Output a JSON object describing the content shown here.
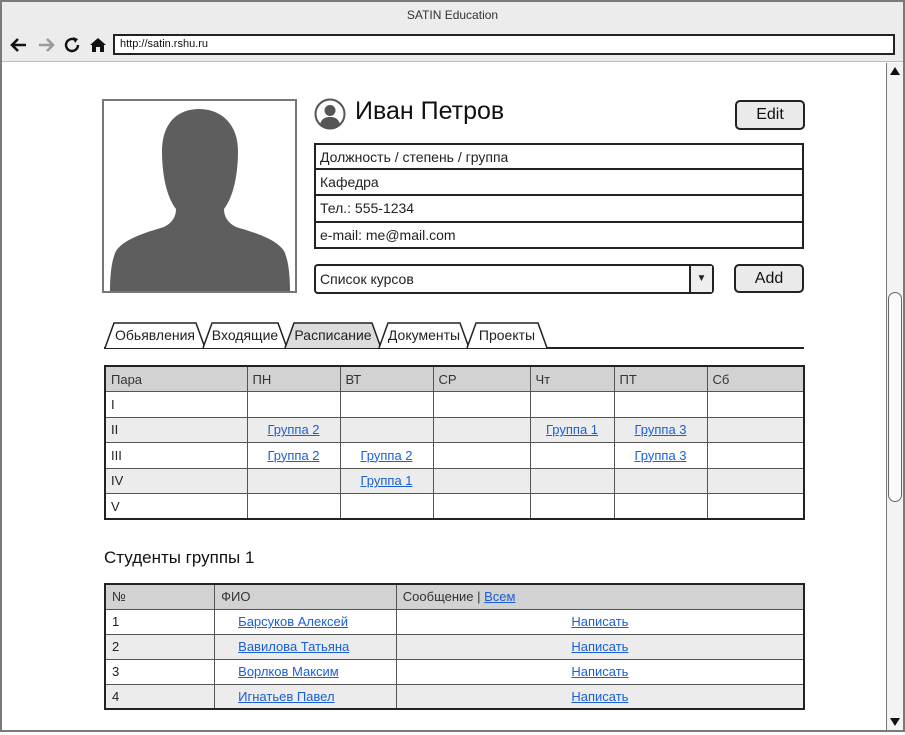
{
  "window": {
    "title": "SATIN Education"
  },
  "browser": {
    "url": "http://satin.rshu.ru"
  },
  "profile": {
    "name": "Иван Петров",
    "edit_label": "Edit",
    "fields": [
      "Должность / степень / группа",
      "Кафедра",
      "Тел.: 555-1234",
      "e-mail: me@mail.com"
    ],
    "course_select": "Список курсов",
    "add_label": "Add"
  },
  "tabs": [
    "Обьявления",
    "Входящие",
    "Расписание",
    "Документы",
    "Проекты"
  ],
  "active_tab": "Расписание",
  "schedule": {
    "headers": [
      "Пара",
      "ПН",
      "ВТ",
      "СР",
      "Чт",
      "ПТ",
      "Сб"
    ],
    "rows": [
      [
        "I",
        "",
        "",
        "",
        "",
        "",
        ""
      ],
      [
        "II",
        "Группа 2",
        "",
        "",
        "Группа 1",
        "Группа 3",
        ""
      ],
      [
        "III",
        "Группа 2",
        "Группа 2",
        "",
        "",
        "Группа 3",
        ""
      ],
      [
        "IV",
        "",
        "Группа 1",
        "",
        "",
        "",
        ""
      ],
      [
        "V",
        "",
        "",
        "",
        "",
        "",
        ""
      ]
    ]
  },
  "students": {
    "title": "Студенты группы 1",
    "headers": {
      "num": "№",
      "fio": "ФИО",
      "message": "Сообщение |",
      "all_link": "Всем"
    },
    "rows": [
      {
        "num": "1",
        "name": "Барсуков Алексей",
        "action": "Написать"
      },
      {
        "num": "2",
        "name": "Вавилова Татьяна",
        "action": "Написать"
      },
      {
        "num": "3",
        "name": "Ворлков Максим",
        "action": "Написать"
      },
      {
        "num": "4",
        "name": "Игнатьев Павел",
        "action": "Написать"
      }
    ]
  },
  "colors": {
    "link": "#1a5fd6",
    "header_bg": "#d2d2d2",
    "alt_row_bg": "#ececec",
    "photo_silhouette": "#5e5e5e"
  }
}
